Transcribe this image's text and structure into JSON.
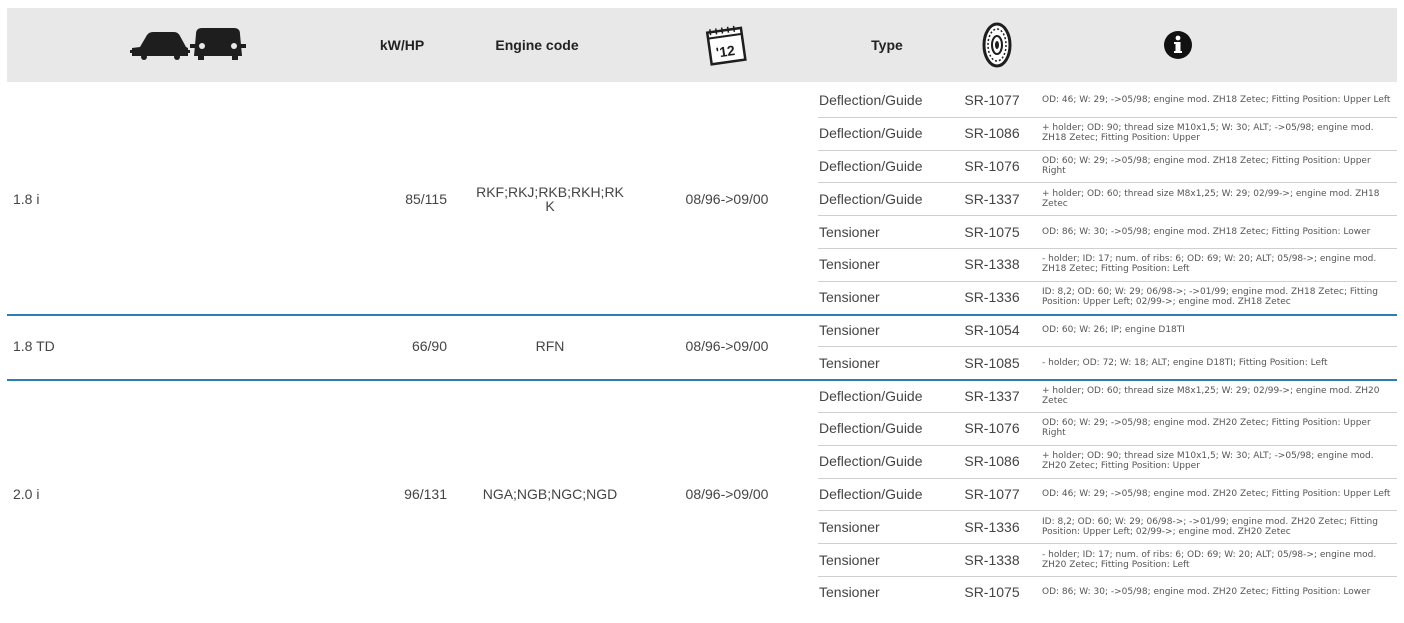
{
  "header": {
    "power": "kW/HP",
    "engine_code": "Engine code",
    "date_icon_text": "'12",
    "type": "Type"
  },
  "icons": [
    "car-body-icon",
    "calendar-icon",
    "tyre-icon",
    "info-icon"
  ],
  "colors": {
    "header_bg": "#e8e8e8",
    "group_divider": "#2b7fb0",
    "row_divider": "#cfcfcf"
  },
  "groups": [
    {
      "model": "1.8 i",
      "power": "85/115",
      "engine": "RKF;RKJ;RKB;RKH;RK\nK",
      "dates": "08/96->09/00",
      "rows": [
        {
          "type": "Deflection/Guide",
          "code": "SR-1077",
          "info": "OD: 46; W: 29; ->05/98; engine mod. ZH18 Zetec; Fitting Position: Upper Left"
        },
        {
          "type": "Deflection/Guide",
          "code": "SR-1086",
          "info": "+ holder; OD: 90; thread size M10x1,5; W: 30; ALT; ->05/98; engine mod. ZH18 Zetec; Fitting Position: Upper"
        },
        {
          "type": "Deflection/Guide",
          "code": "SR-1076",
          "info": "OD: 60; W: 29; ->05/98; engine mod. ZH18 Zetec; Fitting Position: Upper Right"
        },
        {
          "type": "Deflection/Guide",
          "code": "SR-1337",
          "info": "+ holder; OD: 60; thread size M8x1,25; W: 29; 02/99->; engine mod. ZH18 Zetec"
        },
        {
          "type": "Tensioner",
          "code": "SR-1075",
          "info": "OD: 86; W: 30; ->05/98; engine mod. ZH18 Zetec; Fitting Position: Lower"
        },
        {
          "type": "Tensioner",
          "code": "SR-1338",
          "info": "- holder; ID: 17; num. of ribs: 6; OD: 69; W: 20; ALT; 05/98->; engine mod. ZH18 Zetec; Fitting Position: Left"
        },
        {
          "type": "Tensioner",
          "code": "SR-1336",
          "info": "ID: 8,2; OD: 60; W: 29; 06/98->; ->01/99; engine mod. ZH18 Zetec; Fitting Position: Upper Left; 02/99->; engine mod. ZH18 Zetec"
        }
      ]
    },
    {
      "model": "1.8 TD",
      "power": "66/90",
      "engine": "RFN",
      "dates": "08/96->09/00",
      "rows": [
        {
          "type": "Tensioner",
          "code": "SR-1054",
          "info": "OD: 60; W: 26; IP; engine D18TI"
        },
        {
          "type": "Tensioner",
          "code": "SR-1085",
          "info": "- holder; OD: 72; W: 18; ALT; engine D18TI; Fitting Position: Left"
        }
      ]
    },
    {
      "model": "2.0 i",
      "power": "96/131",
      "engine": "NGA;NGB;NGC;NGD",
      "dates": "08/96->09/00",
      "rows": [
        {
          "type": "Deflection/Guide",
          "code": "SR-1337",
          "info": "+ holder; OD: 60; thread size M8x1,25; W: 29; 02/99->; engine mod. ZH20 Zetec"
        },
        {
          "type": "Deflection/Guide",
          "code": "SR-1076",
          "info": "OD: 60; W: 29; ->05/98; engine mod. ZH20 Zetec; Fitting Position: Upper Right"
        },
        {
          "type": "Deflection/Guide",
          "code": "SR-1086",
          "info": "+ holder; OD: 90; thread size M10x1,5; W: 30; ALT; ->05/98; engine mod. ZH20 Zetec; Fitting Position: Upper"
        },
        {
          "type": "Deflection/Guide",
          "code": "SR-1077",
          "info": "OD: 46; W: 29; ->05/98; engine mod. ZH20 Zetec; Fitting Position: Upper Left"
        },
        {
          "type": "Tensioner",
          "code": "SR-1336",
          "info": "ID: 8,2; OD: 60; W: 29; 06/98->; ->01/99; engine mod. ZH20 Zetec; Fitting Position: Upper Left; 02/99->; engine mod. ZH20 Zetec"
        },
        {
          "type": "Tensioner",
          "code": "SR-1338",
          "info": "- holder; ID: 17; num. of ribs: 6; OD: 69; W: 20; ALT; 05/98->; engine mod. ZH20 Zetec; Fitting Position: Left"
        },
        {
          "type": "Tensioner",
          "code": "SR-1075",
          "info": "OD: 86; W: 30; ->05/98; engine mod. ZH20 Zetec; Fitting Position: Lower"
        }
      ]
    }
  ]
}
